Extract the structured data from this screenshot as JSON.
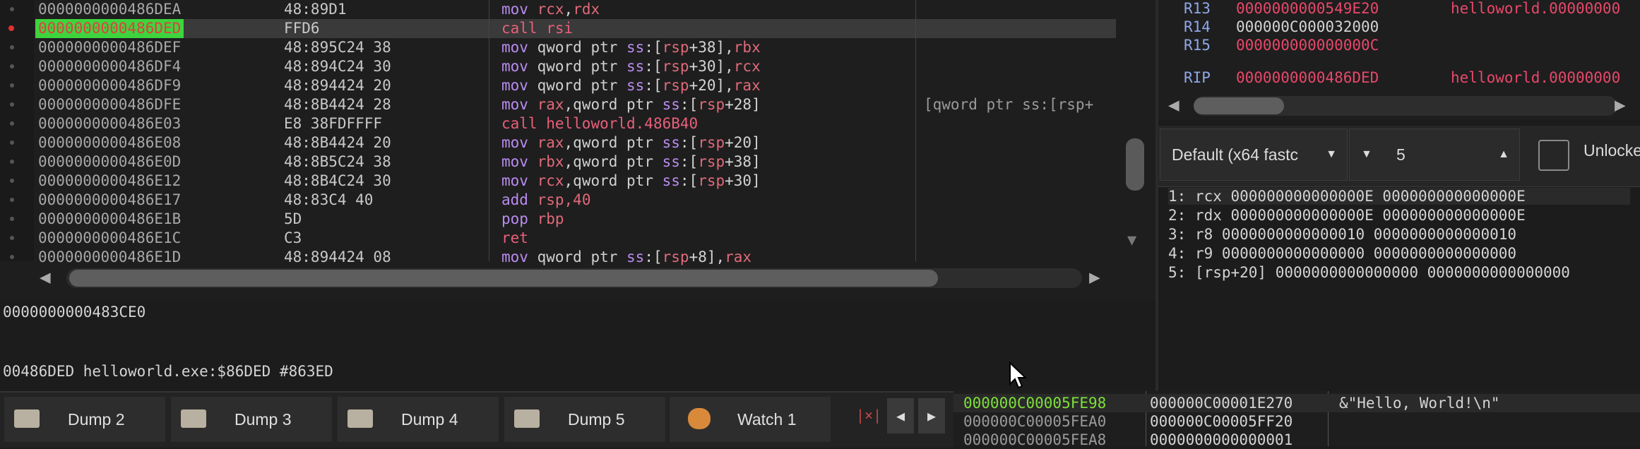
{
  "disasm": {
    "rows": [
      {
        "addr": "0000000000486DEA",
        "bytes": "48:89D1",
        "mn": "mov",
        "ops": [
          {
            "t": "rcx",
            "c": "reg"
          },
          {
            "t": ",",
            "c": ""
          },
          {
            "t": "rdx",
            "c": "reg"
          }
        ],
        "comment": ""
      },
      {
        "addr": "0000000000486DED",
        "bytes": "FFD6",
        "mn": "call",
        "ops": [
          {
            "t": "rsi",
            "c": "call"
          }
        ],
        "comment": "",
        "current": true
      },
      {
        "addr": "0000000000486DEF",
        "bytes": "48:895C24 38",
        "mn": "mov",
        "ops": [
          {
            "t": "qword ptr ",
            "c": "num"
          },
          {
            "t": "ss",
            "c": "kw"
          },
          {
            "t": ":[",
            "c": ""
          },
          {
            "t": "rsp",
            "c": "reg"
          },
          {
            "t": "+38],",
            "c": ""
          },
          {
            "t": "rbx",
            "c": "reg"
          }
        ],
        "comment": ""
      },
      {
        "addr": "0000000000486DF4",
        "bytes": "48:894C24 30",
        "mn": "mov",
        "ops": [
          {
            "t": "qword ptr ",
            "c": "num"
          },
          {
            "t": "ss",
            "c": "kw"
          },
          {
            "t": ":[",
            "c": ""
          },
          {
            "t": "rsp",
            "c": "reg"
          },
          {
            "t": "+30],",
            "c": ""
          },
          {
            "t": "rcx",
            "c": "reg"
          }
        ],
        "comment": ""
      },
      {
        "addr": "0000000000486DF9",
        "bytes": "48:894424 20",
        "mn": "mov",
        "ops": [
          {
            "t": "qword ptr ",
            "c": "num"
          },
          {
            "t": "ss",
            "c": "kw"
          },
          {
            "t": ":[",
            "c": ""
          },
          {
            "t": "rsp",
            "c": "reg"
          },
          {
            "t": "+20],",
            "c": ""
          },
          {
            "t": "rax",
            "c": "reg"
          }
        ],
        "comment": ""
      },
      {
        "addr": "0000000000486DFE",
        "bytes": "48:8B4424 28",
        "mn": "mov",
        "ops": [
          {
            "t": "rax",
            "c": "reg"
          },
          {
            "t": ",qword ptr ",
            "c": "num"
          },
          {
            "t": "ss",
            "c": "kw"
          },
          {
            "t": ":[",
            "c": ""
          },
          {
            "t": "rsp",
            "c": "reg"
          },
          {
            "t": "+28]",
            "c": ""
          }
        ],
        "comment": "[qword ptr ss:[rsp+"
      },
      {
        "addr": "0000000000486E03",
        "bytes": "E8 38FDFFFF",
        "mn": "call",
        "ops": [
          {
            "t": "helloworld.486B40",
            "c": "call"
          }
        ],
        "comment": ""
      },
      {
        "addr": "0000000000486E08",
        "bytes": "48:8B4424 20",
        "mn": "mov",
        "ops": [
          {
            "t": "rax",
            "c": "reg"
          },
          {
            "t": ",qword ptr ",
            "c": "num"
          },
          {
            "t": "ss",
            "c": "kw"
          },
          {
            "t": ":[",
            "c": ""
          },
          {
            "t": "rsp",
            "c": "reg"
          },
          {
            "t": "+20]",
            "c": ""
          }
        ],
        "comment": ""
      },
      {
        "addr": "0000000000486E0D",
        "bytes": "48:8B5C24 38",
        "mn": "mov",
        "ops": [
          {
            "t": "rbx",
            "c": "reg"
          },
          {
            "t": ",qword ptr ",
            "c": "num"
          },
          {
            "t": "ss",
            "c": "kw"
          },
          {
            "t": ":[",
            "c": ""
          },
          {
            "t": "rsp",
            "c": "reg"
          },
          {
            "t": "+38]",
            "c": ""
          }
        ],
        "comment": ""
      },
      {
        "addr": "0000000000486E12",
        "bytes": "48:8B4C24 30",
        "mn": "mov",
        "ops": [
          {
            "t": "rcx",
            "c": "reg"
          },
          {
            "t": ",qword ptr ",
            "c": "num"
          },
          {
            "t": "ss",
            "c": "kw"
          },
          {
            "t": ":[",
            "c": ""
          },
          {
            "t": "rsp",
            "c": "reg"
          },
          {
            "t": "+30]",
            "c": ""
          }
        ],
        "comment": ""
      },
      {
        "addr": "0000000000486E17",
        "bytes": "48:83C4 40",
        "mn": "add",
        "ops": [
          {
            "t": "rsp",
            "c": "reg"
          },
          {
            "t": ",40",
            "c": "reg"
          }
        ],
        "comment": ""
      },
      {
        "addr": "0000000000486E1B",
        "bytes": "5D",
        "mn": "pop",
        "ops": [
          {
            "t": "rbp",
            "c": "reg"
          }
        ],
        "comment": ""
      },
      {
        "addr": "0000000000486E1C",
        "bytes": "C3",
        "mn": "ret",
        "ops": [],
        "comment": "",
        "ret": true
      },
      {
        "addr": "0000000000486E1D",
        "bytes": "48:894424 08",
        "mn": "mov",
        "ops": [
          {
            "t": "qword ptr ",
            "c": "num"
          },
          {
            "t": "ss",
            "c": "kw"
          },
          {
            "t": ":[",
            "c": ""
          },
          {
            "t": "rsp",
            "c": "reg"
          },
          {
            "t": "+8],",
            "c": ""
          },
          {
            "t": "rax",
            "c": "reg"
          }
        ],
        "comment": ""
      }
    ]
  },
  "log": {
    "line1": "0000000000483CE0",
    "line2": "00486DED helloworld.exe:$86DED #863ED"
  },
  "registers": [
    {
      "name": "R13",
      "value": "0000000000549E20",
      "sym": "helloworld.00000000",
      "changed": true
    },
    {
      "name": "R14",
      "value": "000000C000032000",
      "sym": "",
      "changed": false
    },
    {
      "name": "R15",
      "value": "000000000000000C",
      "sym": "",
      "changed": true
    },
    {
      "name": "RIP",
      "value": "0000000000486DED",
      "sym": "helloworld.00000000",
      "changed": true
    }
  ],
  "callconv": {
    "selected": "Default (x64 fastc",
    "count": "5",
    "unlock_label": "Unlocke"
  },
  "args": [
    "1: rcx 000000000000000E 000000000000000E",
    "2: rdx 000000000000000E 000000000000000E",
    "3: r8 0000000000000010 0000000000000010",
    "4: r9 0000000000000000 0000000000000000",
    "5: [rsp+20] 0000000000000000 0000000000000000"
  ],
  "tabs": [
    {
      "label": "Dump 2",
      "icon": "dump-icon"
    },
    {
      "label": "Dump 3",
      "icon": "dump-icon"
    },
    {
      "label": "Dump 4",
      "icon": "dump-icon"
    },
    {
      "label": "Dump 5",
      "icon": "dump-icon"
    },
    {
      "label": "Watch 1",
      "icon": "watch-icon"
    }
  ],
  "tabnav": {
    "prev": "◀",
    "next": "▶"
  },
  "stack": [
    {
      "addr": "000000C00005FE98",
      "value": "000000C00001E270",
      "comment": "&\"Hello, World!\\n\"",
      "current": true
    },
    {
      "addr": "000000C00005FEA0",
      "value": "000000C00005FF20",
      "comment": ""
    },
    {
      "addr": "000000C00005FEA8",
      "value": "0000000000000001",
      "comment": ""
    }
  ],
  "colors": {
    "current_addr_bg": "#3ed43e",
    "current_addr_fg": "#e04040",
    "register_changed": "#e8486a",
    "mnemonic": "#e06a7a"
  }
}
